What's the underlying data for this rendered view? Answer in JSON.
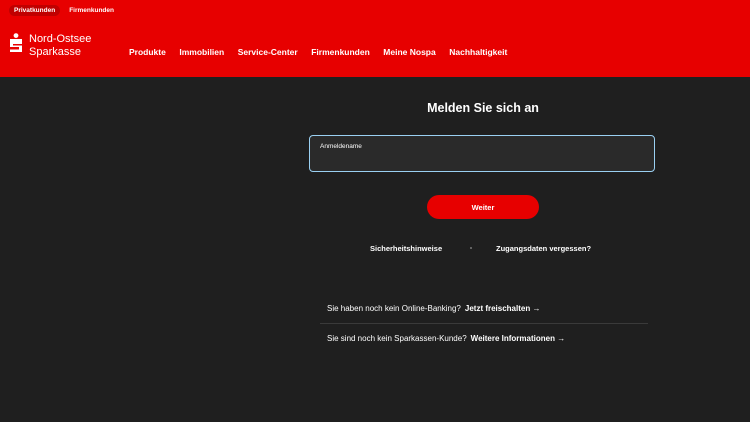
{
  "header": {
    "brand_color": "#e70000",
    "segments": [
      {
        "label": "Privatkunden",
        "active": true
      },
      {
        "label": "Firmenkunden",
        "active": false
      }
    ],
    "logo": {
      "line1": "Nord-Ostsee",
      "line2": "Sparkasse",
      "icon": "sparkasse-s-logo"
    },
    "nav": [
      "Produkte",
      "Immobilien",
      "Service-Center",
      "Firmenkunden",
      "Meine Nospa",
      "Nachhaltigkeit"
    ]
  },
  "login": {
    "title": "Melden Sie sich an",
    "username_label": "Anmeldename",
    "username_value": "",
    "continue_label": "Weiter",
    "field_border_color": "#9ad0f2",
    "links": {
      "security": "Sicherheitshinweise",
      "forgot": "Zugangsdaten vergessen?"
    }
  },
  "info": {
    "online_banking_text": "Sie haben noch kein Online-Banking?",
    "online_banking_link": "Jetzt freischalten →",
    "customer_text": "Sie sind noch kein Sparkassen-Kunde?",
    "customer_link": "Weitere Informationen →"
  }
}
